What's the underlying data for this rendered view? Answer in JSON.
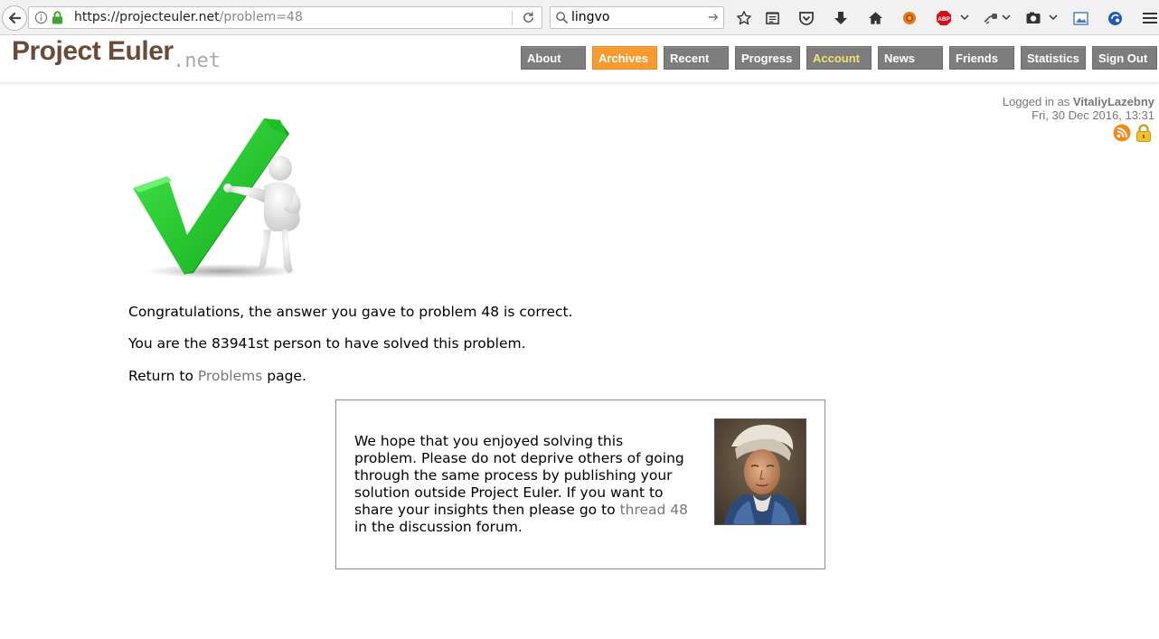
{
  "browser": {
    "url_host": "https://projecteuler.net",
    "url_path": "/problem=48",
    "search_query": "lingvo"
  },
  "site": {
    "logo_main": "Project Euler",
    "logo_suffix": ".net",
    "menu": [
      {
        "label": "About"
      },
      {
        "label": "Archives"
      },
      {
        "label": "Recent"
      },
      {
        "label": "Progress"
      },
      {
        "label": "Account"
      },
      {
        "label": "News"
      },
      {
        "label": "Friends"
      },
      {
        "label": "Statistics"
      },
      {
        "label": "Sign Out"
      }
    ],
    "active_menu": "Archives"
  },
  "login": {
    "prefix": "Logged in as ",
    "username": "VitaliyLazebny",
    "datetime": "Fri, 30 Dec 2016, 13:31"
  },
  "content": {
    "congrats": "Congratulations, the answer you gave to problem 48 is correct.",
    "solver_text": "You are the 83941st person to have solved this problem.",
    "return_prefix": "Return to ",
    "return_link": "Problems",
    "return_suffix": " page."
  },
  "note": {
    "text_before_link": "We hope that you enjoyed solving this problem. Please do not deprive others of going through the same process by publishing your solution outside Project Euler. If you want to share your insights then please go to ",
    "link": "thread 48",
    "text_after_link": " in the discussion forum."
  },
  "colors": {
    "accent_orange": "#f79a30",
    "menu_gray": "#7d7d7d",
    "logo_brown": "#6b4b38",
    "check_green": "#22c22c",
    "account_yellow": "#f0e36b"
  },
  "icons": [
    "back-arrow-icon",
    "info-icon",
    "lock-icon",
    "reload-icon",
    "search-icon",
    "search-go-icon",
    "star-icon",
    "reading-list-icon",
    "pocket-icon",
    "download-icon",
    "home-icon",
    "extension-icon",
    "adblock-icon",
    "dropdown-icon",
    "mouse-gesture-icon",
    "screenshot-icon",
    "image-icon",
    "blue-extension-icon",
    "menu-icon",
    "rss-icon",
    "padlock-icon"
  ]
}
